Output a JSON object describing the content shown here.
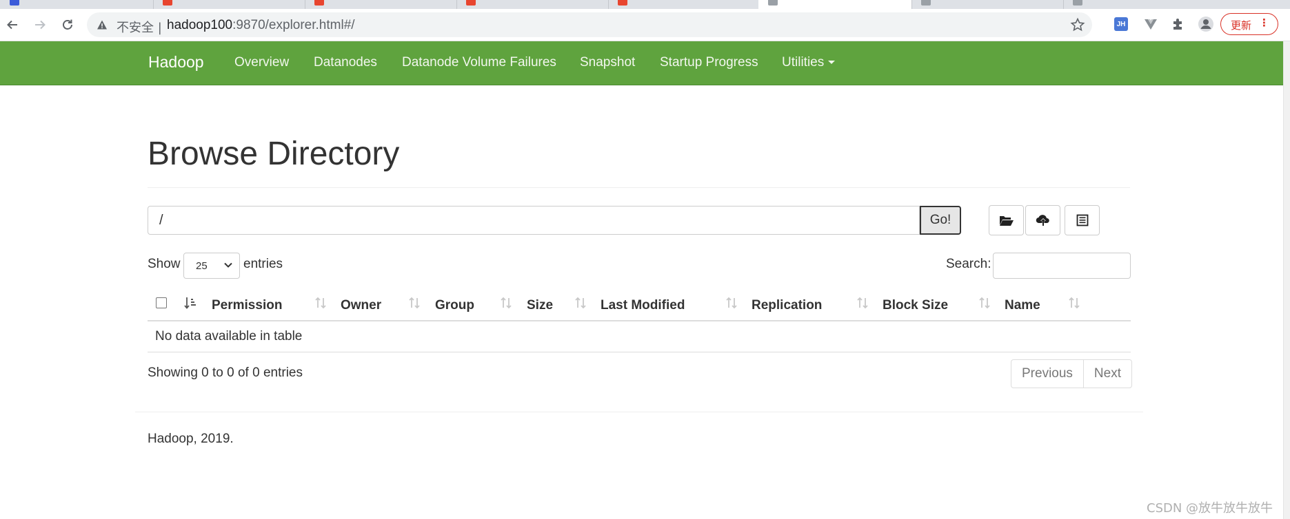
{
  "browser": {
    "tabs": [
      {
        "favicon_color": "#3c5bd9",
        "active": false
      },
      {
        "favicon_color": "#e8452f",
        "active": false
      },
      {
        "favicon_color": "#e8452f",
        "active": false
      },
      {
        "favicon_color": "#e8452f",
        "active": false
      },
      {
        "favicon_color": "#e8452f",
        "active": false
      },
      {
        "favicon_color": "#9aa0a6",
        "active": true
      },
      {
        "favicon_color": "#9aa0a6",
        "active": false
      },
      {
        "favicon_color": "#9aa0a6",
        "active": false
      }
    ],
    "address": {
      "insecure_label": "不安全",
      "host": "hadoop100",
      "rest": ":9870/explorer.html#/"
    },
    "extensions": {
      "jh_label": "JH"
    },
    "update_button": {
      "label": "更新",
      "menu_glyph": "⋮"
    }
  },
  "navbar": {
    "brand": "Hadoop",
    "color": "#5fa33e",
    "items": [
      {
        "label": "Overview"
      },
      {
        "label": "Datanodes"
      },
      {
        "label": "Datanode Volume Failures"
      },
      {
        "label": "Snapshot"
      },
      {
        "label": "Startup Progress"
      },
      {
        "label": "Utilities"
      }
    ]
  },
  "page": {
    "title": "Browse Directory",
    "path_value": "/",
    "go_label": "Go!",
    "icon_buttons": [
      "folder-open-icon",
      "cloud-upload-icon",
      "list-icon"
    ]
  },
  "table": {
    "show_label": "Show",
    "page_size": "25",
    "entries_label": "entries",
    "search_label": "Search:",
    "search_value": "",
    "columns": [
      "Permission",
      "Owner",
      "Group",
      "Size",
      "Last Modified",
      "Replication",
      "Block Size",
      "Name"
    ],
    "empty_message": "No data available in table",
    "info": "Showing 0 to 0 of 0 entries",
    "pagination": {
      "previous": "Previous",
      "next": "Next"
    }
  },
  "footer": {
    "text": "Hadoop, 2019."
  },
  "watermark": "CSDN @放牛放牛放牛"
}
